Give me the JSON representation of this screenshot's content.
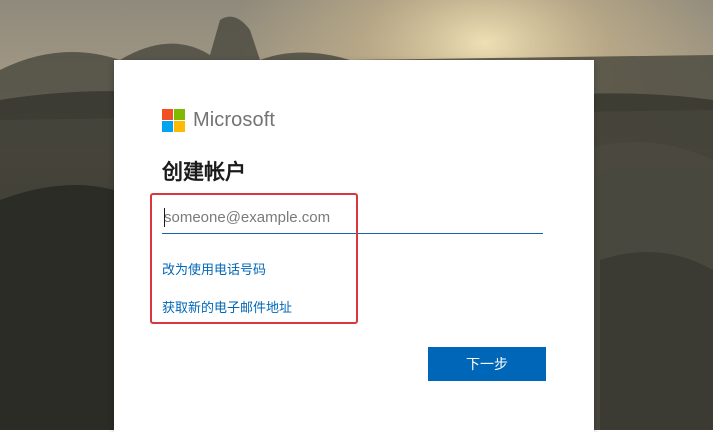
{
  "brand": {
    "name": "Microsoft",
    "logo_colors": [
      "#f25022",
      "#7fba00",
      "#00a4ef",
      "#ffb900"
    ]
  },
  "signup": {
    "title": "创建帐户",
    "email_placeholder": "someone@example.com",
    "email_value": "",
    "use_phone_link": "改为使用电话号码",
    "get_new_email_link": "获取新的电子邮件地址",
    "next_button": "下一步"
  },
  "colors": {
    "accent": "#0067b8",
    "annotation": "#d9363e"
  }
}
